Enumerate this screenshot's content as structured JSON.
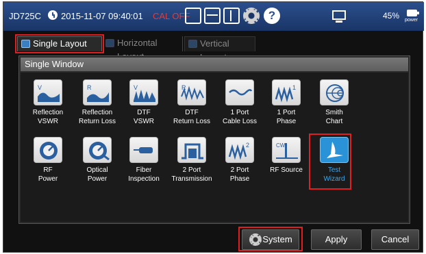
{
  "statusbar": {
    "model": "JD725C",
    "datetime": "2015-11-07 09:40:01",
    "cal_status": "CAL OFF",
    "battery": "45%",
    "power_label": "power",
    "icons": [
      "layout-single-icon",
      "layout-horizontal-icon",
      "layout-vertical-icon",
      "gear-icon",
      "help-icon",
      "monitor-icon",
      "power-plug-icon"
    ]
  },
  "tabs": [
    {
      "label": "Single Layout",
      "selected": true
    },
    {
      "label": "Horizontal Layout",
      "selected": false
    },
    {
      "label": "Vertical Layout",
      "selected": false
    }
  ],
  "panel": {
    "title": "Single Window"
  },
  "tiles": [
    {
      "line1": "Reflection",
      "line2": "VSWR"
    },
    {
      "line1": "Reflection",
      "line2": "Return Loss"
    },
    {
      "line1": "DTF",
      "line2": "VSWR"
    },
    {
      "line1": "DTF",
      "line2": "Return Loss"
    },
    {
      "line1": "1 Port",
      "line2": "Cable Loss"
    },
    {
      "line1": "1 Port",
      "line2": "Phase"
    },
    {
      "line1": "Smith",
      "line2": "Chart"
    },
    {
      "line1": "RF",
      "line2": "Power"
    },
    {
      "line1": "Optical",
      "line2": "Power"
    },
    {
      "line1": "Fiber",
      "line2": "Inspection"
    },
    {
      "line1": "2 Port",
      "line2": "Transmission"
    },
    {
      "line1": "2 Port",
      "line2": "Phase"
    },
    {
      "line1": "RF Source",
      "line2": ""
    },
    {
      "line1": "Test",
      "line2": "Wizard"
    }
  ],
  "buttons": {
    "system": "System",
    "apply": "Apply",
    "cancel": "Cancel"
  },
  "icon_letters": {
    "v": "V",
    "r": "R",
    "one": "1",
    "two": "2",
    "cw": "CW"
  },
  "colors": {
    "statusbar": "#2b4f8d",
    "cal_off": "#e23b3b",
    "highlight": "#e02020",
    "wizard_active": "#2a93d8",
    "wizard_text": "#3aa8f0"
  }
}
